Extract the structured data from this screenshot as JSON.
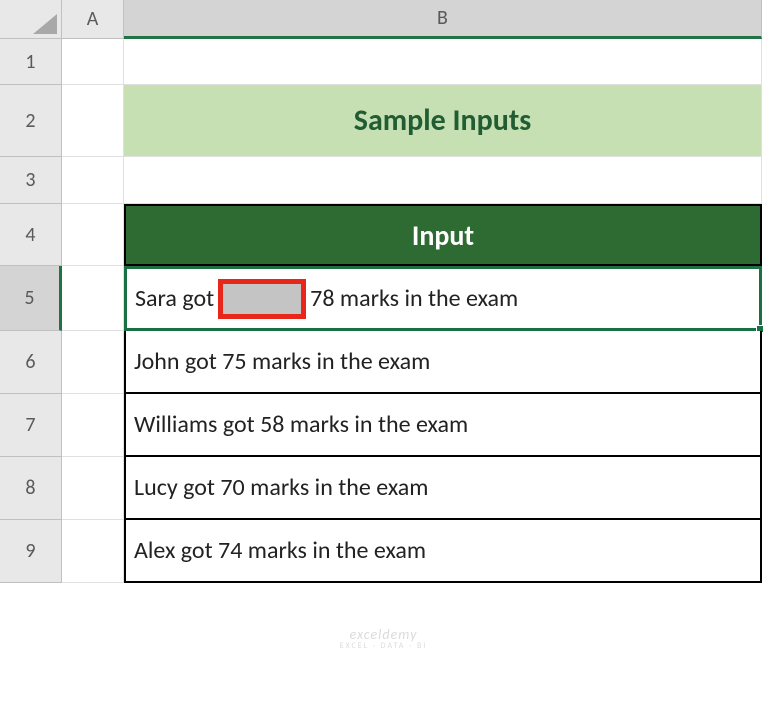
{
  "columns": [
    "A",
    "B"
  ],
  "rows": [
    "1",
    "2",
    "3",
    "4",
    "5",
    "6",
    "7",
    "8",
    "9"
  ],
  "title": "Sample Inputs",
  "table_header": "Input",
  "b5_pre": "Sara got",
  "b5_post": "78 marks in the exam",
  "data_rows": {
    "r6": "John got 75 marks in the exam",
    "r7": "Williams got 58 marks in the exam",
    "r8": "Lucy got 70 marks in the exam",
    "r9": "Alex got 74 marks in the exam"
  },
  "watermark": {
    "name": "exceldemy",
    "tag": "EXCEL · DATA · BI"
  },
  "selected_cell": "B5"
}
